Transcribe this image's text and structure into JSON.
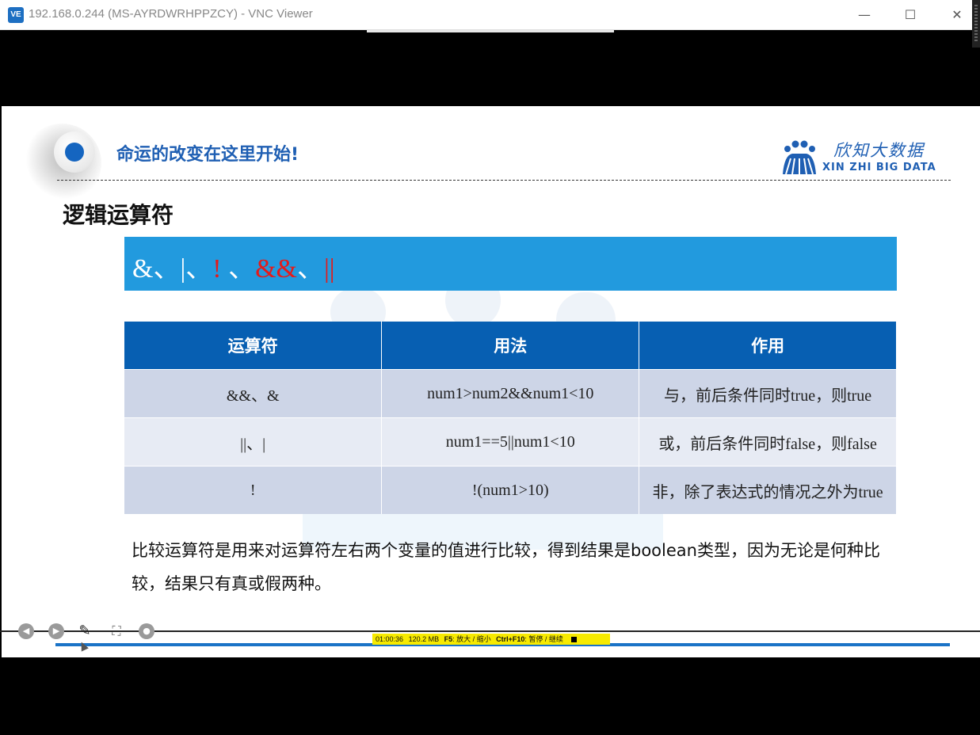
{
  "window": {
    "app_icon_label": "VE",
    "title": "192.168.0.244 (MS-AYRDWRHPPZCY) - VNC Viewer",
    "minimize": "—",
    "maximize": "☐",
    "close": "✕"
  },
  "slide": {
    "slogan": "命运的改变在这里开始!",
    "brand_cn": "欣知大数据",
    "brand_en": "XIN ZHI BIG DATA",
    "title": "逻辑运算符",
    "banner": {
      "parts": [
        {
          "text": "&、",
          "color": "white"
        },
        {
          "text": "|、",
          "color": "white"
        },
        {
          "text": "!",
          "color": "red"
        },
        {
          "text": " 、",
          "color": "white"
        },
        {
          "text": "&&",
          "color": "red"
        },
        {
          "text": "、",
          "color": "white"
        },
        {
          "text": "||",
          "color": "red"
        }
      ]
    },
    "table": {
      "headers": [
        "运算符",
        "用法",
        "作用"
      ],
      "rows": [
        [
          "&&、&",
          "num1>num2&&num1<10",
          "与，前后条件同时true，则true"
        ],
        [
          "||、|",
          "num1==5||num1<10",
          "或，前后条件同时false，则false"
        ],
        [
          "!",
          "!(num1>10)",
          "非，除了表达式的情况之外为true"
        ]
      ]
    },
    "explanation": "比较运算符是用来对运算符左右两个变量的值进行比较，得到结果是boolean类型，因为无论是何种比较，结果只有真或假两种。"
  },
  "recorder": {
    "time": "01:00:36",
    "memory": "120.2 MB",
    "f5_key": "F5",
    "f5_action": ": 放大 / 缩小",
    "ctrl_key": "Ctrl+F10",
    "ctrl_action": ": 暂停 / 继续",
    "progress": 1.0
  },
  "icons": {
    "prev": "◀",
    "next": "▶",
    "pen": "✎",
    "zoom": "⛶",
    "more": "●"
  },
  "colors": {
    "banner_blue": "#229ade",
    "header_blue": "#075fb2",
    "accent_red": "#e51a1a",
    "slogan_blue": "#1f5fb3",
    "recorder_yellow": "#f7ea00"
  }
}
